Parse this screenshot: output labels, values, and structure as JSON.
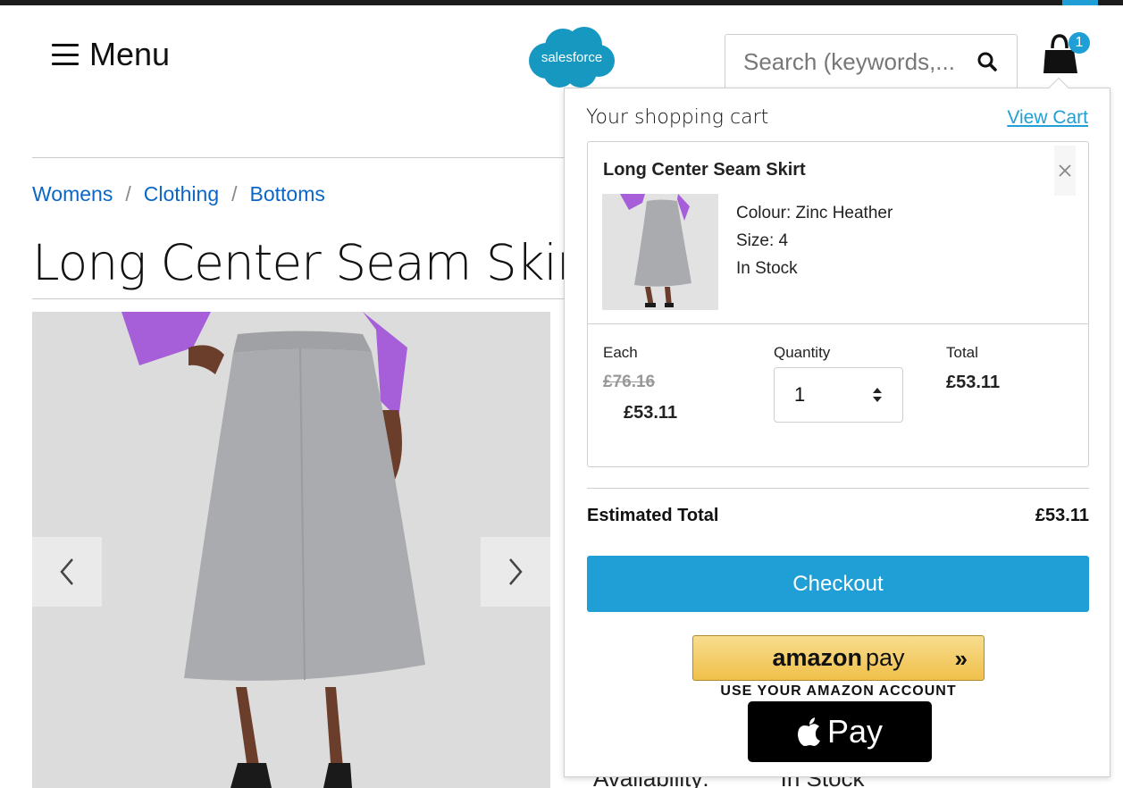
{
  "header": {
    "menu_label": "Menu",
    "logo_text": "salesforce",
    "search_placeholder": "Search (keywords,...",
    "cart_count": "1"
  },
  "breadcrumb": [
    "Womens",
    "Clothing",
    "Bottoms"
  ],
  "product": {
    "title": "Long Center Seam Skirt",
    "availability_label": "Availability:",
    "availability_value": "In Stock"
  },
  "minicart": {
    "title": "Your shopping cart",
    "view_cart": "View Cart",
    "item": {
      "name": "Long Center Seam Skirt",
      "colour": "Colour: Zinc Heather",
      "size": "Size: 4",
      "stock": "In Stock",
      "each_label": "Each",
      "quantity_label": "Quantity",
      "total_label": "Total",
      "original_price": "£76.16",
      "sale_price": "£53.11",
      "quantity": "1",
      "line_total": "£53.11"
    },
    "estimated_total_label": "Estimated Total",
    "estimated_total_value": "£53.11",
    "checkout_label": "Checkout",
    "amazon_pay": {
      "brand_bold": "amazon",
      "brand_light": "pay",
      "chevron": "»",
      "subtitle": "USE YOUR AMAZON ACCOUNT"
    },
    "apple_pay_label": "Pay"
  },
  "colors": {
    "accent": "#1f9fd6",
    "link": "#0b66c8",
    "amazon_gold": "#f0c04a",
    "blouse_purple": "#a65fd9",
    "skirt_grey": "#a9abaf"
  },
  "icons": [
    "hamburger-icon",
    "salesforce-logo",
    "search-icon",
    "shopping-bag-icon",
    "close-icon",
    "chevron-left-icon",
    "chevron-right-icon",
    "stepper-icon",
    "apple-logo-icon"
  ]
}
